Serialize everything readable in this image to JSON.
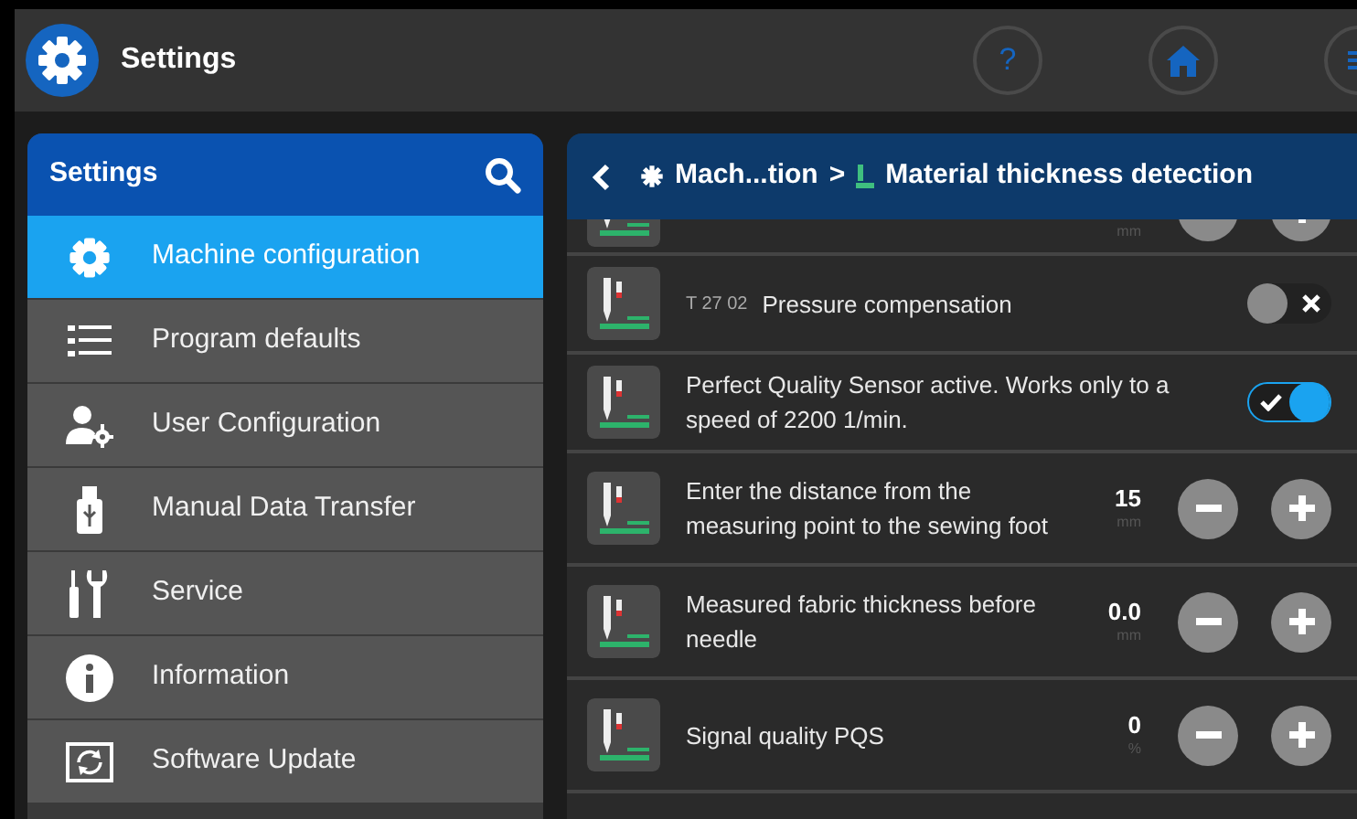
{
  "app_bar": {
    "title": "Settings",
    "help_glyph": "?"
  },
  "sidebar": {
    "title": "Settings",
    "items": [
      {
        "label": "Machine configuration",
        "selected": true
      },
      {
        "label": "Program defaults",
        "selected": false
      },
      {
        "label": "User Configuration",
        "selected": false
      },
      {
        "label": "Manual Data Transfer",
        "selected": false
      },
      {
        "label": "Service",
        "selected": false
      },
      {
        "label": "Information",
        "selected": false
      },
      {
        "label": "Software Update",
        "selected": false
      }
    ]
  },
  "detail": {
    "breadcrumb": {
      "parent": "Mach...tion",
      "separator": ">",
      "current": "Material thickness detection"
    },
    "rows": [
      {
        "kind": "partial",
        "unit": "mm"
      },
      {
        "kind": "toggle",
        "code": "T 27 02",
        "label": "Pressure compensation",
        "on": false
      },
      {
        "kind": "toggle",
        "label": "Perfect Quality Sensor active. Works only to a speed of 2200 1/min.",
        "on": true
      },
      {
        "kind": "stepper",
        "label": "Enter the distance from the measuring point to the sewing foot",
        "value": "15",
        "unit": "mm"
      },
      {
        "kind": "stepper",
        "label": "Measured fabric thickness before needle",
        "value": "0.0",
        "unit": "mm"
      },
      {
        "kind": "stepper",
        "label": "Signal quality PQS",
        "value": "0",
        "unit": "%"
      }
    ]
  }
}
